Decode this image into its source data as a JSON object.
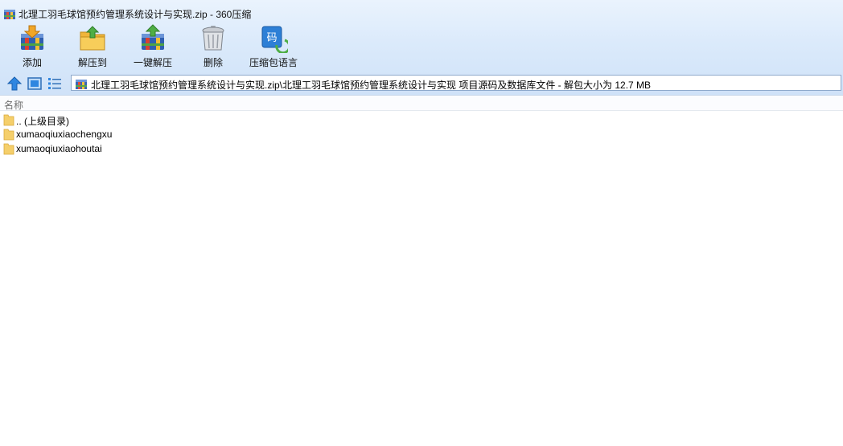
{
  "window": {
    "title": "北理工羽毛球馆预约管理系统设计与实现.zip - 360压缩",
    "app_icon": "archive-icon"
  },
  "toolbar": {
    "items": [
      {
        "label": "添加",
        "icon": "add-archive-icon"
      },
      {
        "label": "解压到",
        "icon": "extract-to-folder-icon"
      },
      {
        "label": "一键解压",
        "icon": "quick-extract-icon"
      },
      {
        "label": "删除",
        "icon": "trash-can-icon"
      },
      {
        "label": "压缩包语言",
        "icon": "encoding-icon",
        "glyph": "码"
      }
    ]
  },
  "navbar": {
    "buttons": [
      {
        "icon": "up-arrow-icon"
      },
      {
        "icon": "thumbnail-view-icon"
      },
      {
        "icon": "list-view-icon"
      }
    ],
    "address": "北理工羽毛球馆预约管理系统设计与实现.zip\\北理工羽毛球馆预约管理系统设计与实现 项目源码及数据库文件 - 解包大小为 12.7 MB"
  },
  "file_list": {
    "column_name": "名称",
    "rows": [
      {
        "name": ".. (上级目录)",
        "icon": "folder-icon"
      },
      {
        "name": "xumaoqiuxiaochengxu",
        "icon": "folder-icon"
      },
      {
        "name": "xumaoqiuxiaohoutai",
        "icon": "folder-icon"
      }
    ]
  },
  "colors": {
    "toolbar_top": "#eaf3fd",
    "toolbar_bottom": "#cfe2f8",
    "address_border": "#8ea9cc",
    "folder_yellow": "#f5cf6b",
    "accent_blue": "#2d7fd6"
  }
}
